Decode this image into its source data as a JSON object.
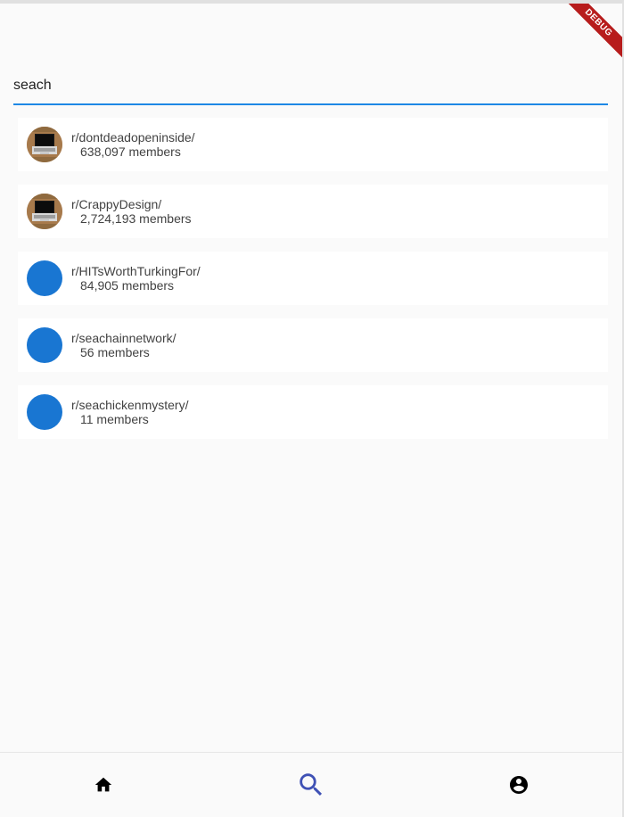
{
  "debug_banner": {
    "label": "DEBUG"
  },
  "search": {
    "value": "seach"
  },
  "results": [
    {
      "name": "r/dontdeadopeninside/",
      "members": "638,097 members",
      "avatar": "laptop-photo"
    },
    {
      "name": "r/CrappyDesign/",
      "members": "2,724,193 members",
      "avatar": "laptop-photo"
    },
    {
      "name": "r/HITsWorthTurkingFor/",
      "members": "84,905 members",
      "avatar": "blue-circle"
    },
    {
      "name": "r/seachainnetwork/",
      "members": "56 members",
      "avatar": "blue-circle"
    },
    {
      "name": "r/seachickenmystery/",
      "members": "11 members",
      "avatar": "blue-circle"
    }
  ],
  "bottom_nav": {
    "items": [
      {
        "icon": "home-icon",
        "selected": false
      },
      {
        "icon": "search-icon",
        "selected": true
      },
      {
        "icon": "account-circle-icon",
        "selected": false
      }
    ],
    "colors": {
      "selected": "#3f51b5",
      "unselected": "#000000"
    }
  },
  "colors": {
    "accent": "#1e88e5",
    "avatar_default": "#1976d2",
    "debug_ribbon": "#b71c1c"
  }
}
